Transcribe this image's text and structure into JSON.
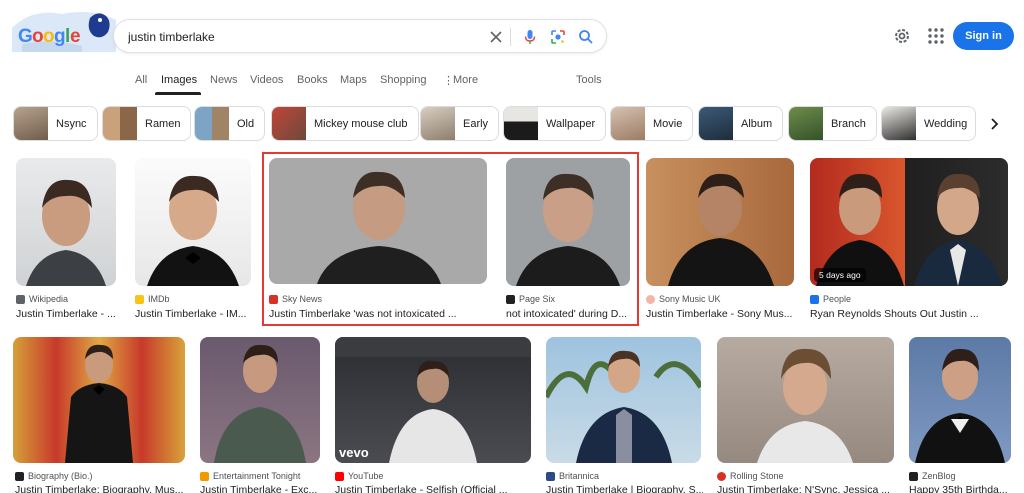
{
  "search": {
    "query": "justin timberlake"
  },
  "header": {
    "signin_label": "Sign in"
  },
  "nav": {
    "tabs": [
      "All",
      "Images",
      "News",
      "Videos",
      "Books",
      "Maps",
      "Shopping",
      "More",
      "Tools"
    ],
    "active": "Images"
  },
  "chips": [
    "Nsync",
    "Ramen",
    "Old",
    "Mickey mouse club",
    "Early",
    "Wallpaper",
    "Movie",
    "Album",
    "Branch",
    "Wedding"
  ],
  "results_row1": [
    {
      "source": "Wikipedia",
      "title": "Justin Timberlake - ..."
    },
    {
      "source": "IMDb",
      "title": "Justin Timberlake - IM..."
    },
    {
      "source": "Sky News",
      "title": "Justin Timberlake 'was not intoxicated ..."
    },
    {
      "source": "Page Six",
      "title": "not intoxicated' during D..."
    },
    {
      "source": "Sony Music UK",
      "title": "Justin Timberlake - Sony Mus..."
    },
    {
      "source": "People",
      "title": "Ryan Reynolds Shouts Out Justin ...",
      "badge": "5 days ago"
    }
  ],
  "results_row2": [
    {
      "source": "Biography (Bio.)",
      "title": "Justin Timberlake: Biography, Mus..."
    },
    {
      "source": "Entertainment Tonight",
      "title": "Justin Timberlake - Exc..."
    },
    {
      "source": "YouTube",
      "title": "Justin Timberlake - Selfish (Official ..."
    },
    {
      "source": "Britannica",
      "title": "Justin Timberlake | Biography, S..."
    },
    {
      "source": "Rolling Stone",
      "title": "Justin Timberlake: N'Sync, Jessica ..."
    },
    {
      "source": "ZenBlog",
      "title": "Happy 35th Birthda..."
    }
  ],
  "icons": [
    "clear-icon",
    "mic-icon",
    "lens-icon",
    "search-icon",
    "gear-icon",
    "apps-icon",
    "chevron-right-icon",
    "more-dots-icon"
  ]
}
